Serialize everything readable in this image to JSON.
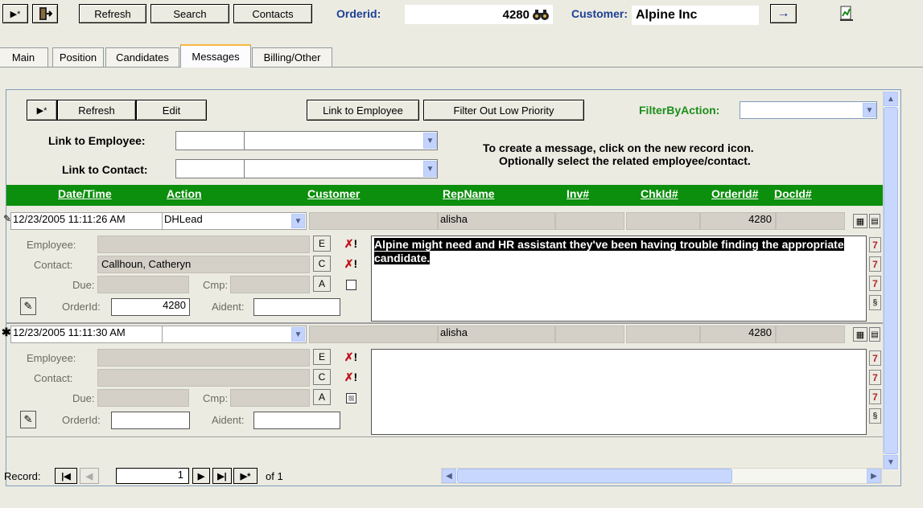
{
  "toolbar": {
    "new_record_glyph": "▶*",
    "exit_icon": "door-exit-icon",
    "refresh_label": "Refresh",
    "search_label": "Search",
    "contacts_label": "Contacts",
    "orderid_label": "Orderid:",
    "orderid_value": "4280",
    "customer_label": "Customer:",
    "customer_value": "Alpine Inc",
    "go_glyph": "→"
  },
  "tabs": [
    {
      "label": "Main"
    },
    {
      "label": "Position"
    },
    {
      "label": "Candidates"
    },
    {
      "label": "Messages"
    },
    {
      "label": "Billing/Other"
    }
  ],
  "subform_toolbar": {
    "new_glyph": "▶*",
    "refresh_label": "Refresh",
    "edit_label": "Edit",
    "link_employee_label": "Link to Employee",
    "filter_low_label": "Filter Out Low Priority",
    "filter_by_action_label": "FilterByAction:",
    "filter_by_action_value": ""
  },
  "links": {
    "employee_label": "Link to Employee:",
    "contact_label": "Link to Contact:",
    "instruction_line1": "To create a message, click on the new record icon.",
    "instruction_line2": "Optionally select the related employee/contact."
  },
  "columns": {
    "datetime": "Date/Time",
    "action": "Action",
    "customer": "Customer",
    "repname": "RepName",
    "inv": "Inv#",
    "chkid": "ChkId#",
    "orderid": "OrderId#",
    "docid": "DocId#"
  },
  "detail_labels": {
    "employee": "Employee:",
    "contact": "Contact:",
    "due": "Due:",
    "cmp": "Cmp:",
    "orderid": "OrderId:",
    "aident": "Aident:",
    "e": "E",
    "c": "C",
    "a": "A",
    "xbang_x": "✗",
    "xbang_bang": "!"
  },
  "records": [
    {
      "marker": "✎",
      "datetime": "12/23/2005 11:11:26 AM",
      "action": "DHLead",
      "customer": "",
      "repname": "alisha",
      "orderid": "4280",
      "employee": "",
      "contact": "Callhoun, Catheryn",
      "orderid_detail": "4280",
      "aident": "",
      "message": "Alpine might need and HR assistant they've been having trouble finding the appropriate candidate."
    },
    {
      "marker": "✱",
      "datetime": "12/23/2005 11:11:30 AM",
      "action": "",
      "customer": "",
      "repname": "alisha",
      "orderid": "4280",
      "employee": "",
      "contact": "",
      "orderid_detail": "",
      "aident": "",
      "message": ""
    }
  ],
  "navigation": {
    "record_label": "Record:",
    "current": "1",
    "of_label": "of 1",
    "first_glyph": "|◀",
    "prev_glyph": "◀",
    "next_glyph": "▶",
    "last_glyph": "▶|",
    "new_glyph": "▶*"
  },
  "colors": {
    "header_green": "#0c8f0c",
    "filter_green": "#1a8f1a",
    "orderid_blue": "#1c3f95"
  }
}
